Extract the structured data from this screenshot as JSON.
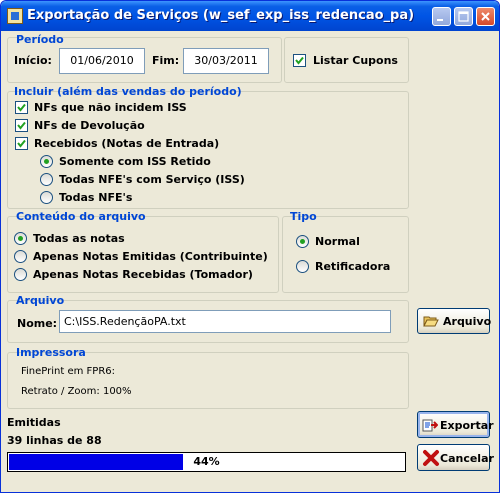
{
  "window": {
    "title": "Exportação de Serviços (w_sef_exp_iss_redencao_pa)",
    "accent": "#0055e5"
  },
  "periodo": {
    "title": "Período",
    "inicio_label": "Início:",
    "inicio_value": "01/06/2010",
    "fim_label": "Fim:",
    "fim_value": "30/03/2011",
    "listar_cupons_label": "Listar Cupons",
    "listar_cupons_checked": true
  },
  "incluir": {
    "title": "Incluir (além das vendas do período)",
    "nfs_nao_incidem_label": "NFs que não incidem ISS",
    "nfs_devolucao_label": "NFs de Devolução",
    "recebidos_label": "Recebidos (Notas de Entrada)",
    "radio_iss_retido": "Somente com ISS Retido",
    "radio_nfe_servico": "Todas NFE's com Serviço (ISS)",
    "radio_todas_nfe": "Todas NFE's",
    "selected": "Somente com ISS Retido"
  },
  "conteudo": {
    "title": "Conteúdo do arquivo",
    "opt_todas": "Todas as notas",
    "opt_emitidas": "Apenas Notas Emitidas (Contribuinte)",
    "opt_recebidas": "Apenas Notas Recebidas (Tomador)",
    "selected": "Todas as notas"
  },
  "tipo": {
    "title": "Tipo",
    "opt_normal": "Normal",
    "opt_retificadora": "Retificadora",
    "selected": "Normal"
  },
  "arquivo": {
    "title": "Arquivo",
    "nome_label": "Nome:",
    "nome_value": "C:\\ISS.RedençãoPA.txt",
    "button_label": "Arquivo"
  },
  "impressora": {
    "title": "Impressora",
    "line1": "FinePrint em FPR6:",
    "line2": "Retrato / Zoom: 100%"
  },
  "status": {
    "title": "Emitidas",
    "count_text": "39 linhas de 88",
    "progress_text": "44%",
    "progress_fraction": 0.44
  },
  "buttons": {
    "exportar": "Exportar",
    "cancelar": "Cancelar"
  }
}
